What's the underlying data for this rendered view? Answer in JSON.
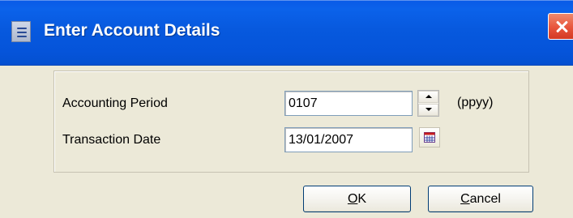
{
  "window": {
    "title": "Enter Account Details"
  },
  "titlebar": {
    "menu_icon": "system-menu-icon",
    "close_icon": "close-icon"
  },
  "form": {
    "accounting_period": {
      "label": "Accounting Period",
      "value": "0107",
      "suffix": "(ppyy)"
    },
    "transaction_date": {
      "label": "Transaction Date",
      "value": "13/01/2007"
    },
    "icons": {
      "spinner_up": "spinner-up-icon",
      "spinner_down": "spinner-down-icon",
      "calendar": "calendar-icon"
    }
  },
  "buttons": {
    "ok_mnemonic": "O",
    "ok_rest": "K",
    "cancel_mnemonic": "C",
    "cancel_rest": "ancel"
  },
  "colors": {
    "titlebar_blue": "#0554da",
    "dialog_background": "#ece9d8",
    "close_red": "#e8543b"
  }
}
